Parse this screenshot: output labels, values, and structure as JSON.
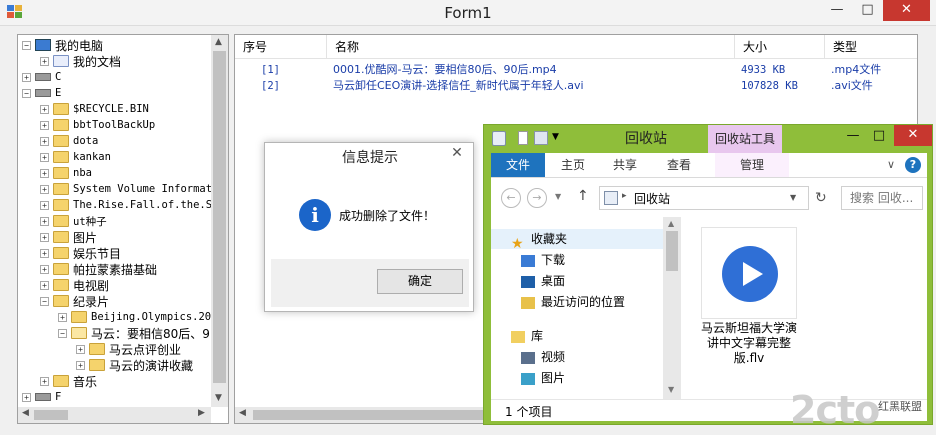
{
  "window": {
    "title": "Form1",
    "minimize": "—",
    "maximize": "□",
    "close": "✕"
  },
  "tree": {
    "nodes": [
      {
        "label": "我的电脑"
      },
      {
        "label": "我的文档"
      },
      {
        "label": "C"
      },
      {
        "label": "E"
      },
      {
        "label": "$RECYCLE.BIN"
      },
      {
        "label": "bbtToolBackUp"
      },
      {
        "label": "dota"
      },
      {
        "label": "kankan"
      },
      {
        "label": "nba"
      },
      {
        "label": "System Volume Informat"
      },
      {
        "label": "The.Rise.Fall.of.the.S"
      },
      {
        "label": "ut种子"
      },
      {
        "label": "图片"
      },
      {
        "label": "娱乐节目"
      },
      {
        "label": "帕拉蒙素描基础"
      },
      {
        "label": "电视剧"
      },
      {
        "label": "纪录片"
      },
      {
        "label": "Beijing.Olympics.20"
      },
      {
        "label": "马云：要相信80后、9"
      },
      {
        "label": "马云点评创业"
      },
      {
        "label": "马云的演讲收藏"
      },
      {
        "label": "音乐"
      },
      {
        "label": "F"
      }
    ]
  },
  "list": {
    "columns": [
      "序号",
      "名称",
      "大小",
      "类型"
    ],
    "rows": [
      {
        "idx": "[1]",
        "name": "0001.优酷网-马云：要相信80后、90后.mp4",
        "size": "4933 KB",
        "type": ".mp4文件"
      },
      {
        "idx": "[2]",
        "name": "马云卸任CEO演讲-选择信任_新时代属于年轻人.avi",
        "size": "107828 KB",
        "type": ".avi文件"
      }
    ]
  },
  "dialog": {
    "title": "信息提示",
    "close": "✕",
    "message": "成功删除了文件！",
    "ok": "确定",
    "icon": "i"
  },
  "explorer": {
    "title": "回收站",
    "tools_tab": "回收站工具",
    "tabs": {
      "file": "文件",
      "home": "主页",
      "share": "共享",
      "view": "查看",
      "manage": "管理"
    },
    "help": "?",
    "path": "回收站",
    "search_placeholder": "搜索 回收...",
    "nav": {
      "favorites": "收藏夹",
      "downloads": "下载",
      "desktop": "桌面",
      "recent": "最近访问的位置",
      "library": "库",
      "videos": "视频",
      "pictures": "图片"
    },
    "file": {
      "name": "马云斯坦福大学演讲中文字幕完整版.flv"
    },
    "status": "1 个项目",
    "colors": {
      "frame": "#8fbe3a",
      "accent_tab": "#1e73be",
      "tools_tab": "#e8c7ee"
    }
  },
  "watermark": {
    "text": "2cto",
    "small": "红黑联盟"
  }
}
